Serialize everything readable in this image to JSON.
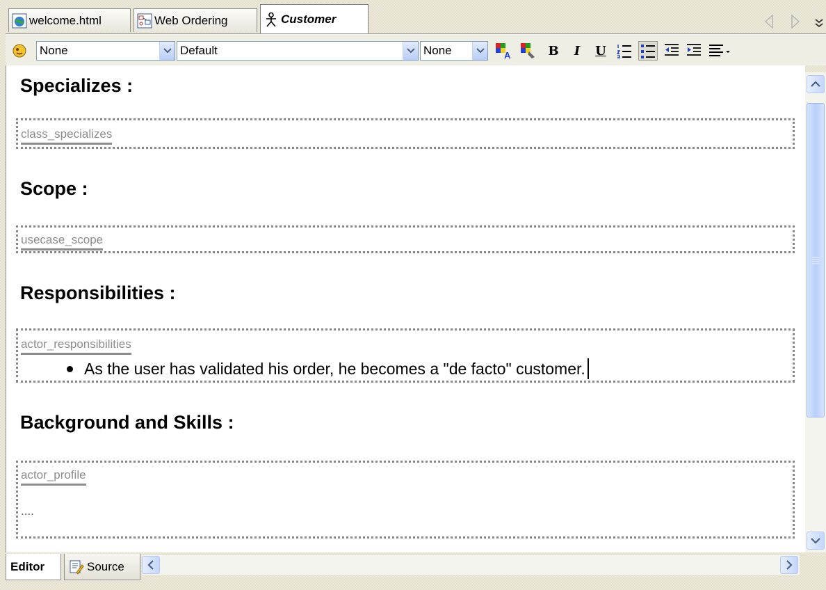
{
  "tabs": [
    {
      "label": "welcome.html",
      "icon": "globe-page-icon"
    },
    {
      "label": "Web Ordering",
      "icon": "diagram-icon"
    },
    {
      "label": "Customer",
      "icon": "actor-icon"
    }
  ],
  "toolbar": {
    "style_combo": "None",
    "font_combo": "Default",
    "size_combo": "None",
    "bold_label": "B",
    "italic_label": "I",
    "underline_label": "U"
  },
  "sections": [
    {
      "heading": "Specializes :",
      "field": "class_specializes",
      "content": []
    },
    {
      "heading": "Scope :",
      "field": "usecase_scope",
      "content": []
    },
    {
      "heading": "Responsibilities :",
      "field": "actor_responsibilities",
      "content": [
        "As the user has validated his order, he becomes a \"de facto\" customer."
      ]
    },
    {
      "heading": "Background and Skills :",
      "field": "actor_profile",
      "content": []
    }
  ],
  "ellipsis": "....",
  "bottom_tabs": {
    "editor": "Editor",
    "source": "Source"
  },
  "colors": {
    "accent_blue": "#b9cdf7",
    "window_bg": "#ece9d8",
    "field_tag_gray": "#8c8c8c"
  }
}
